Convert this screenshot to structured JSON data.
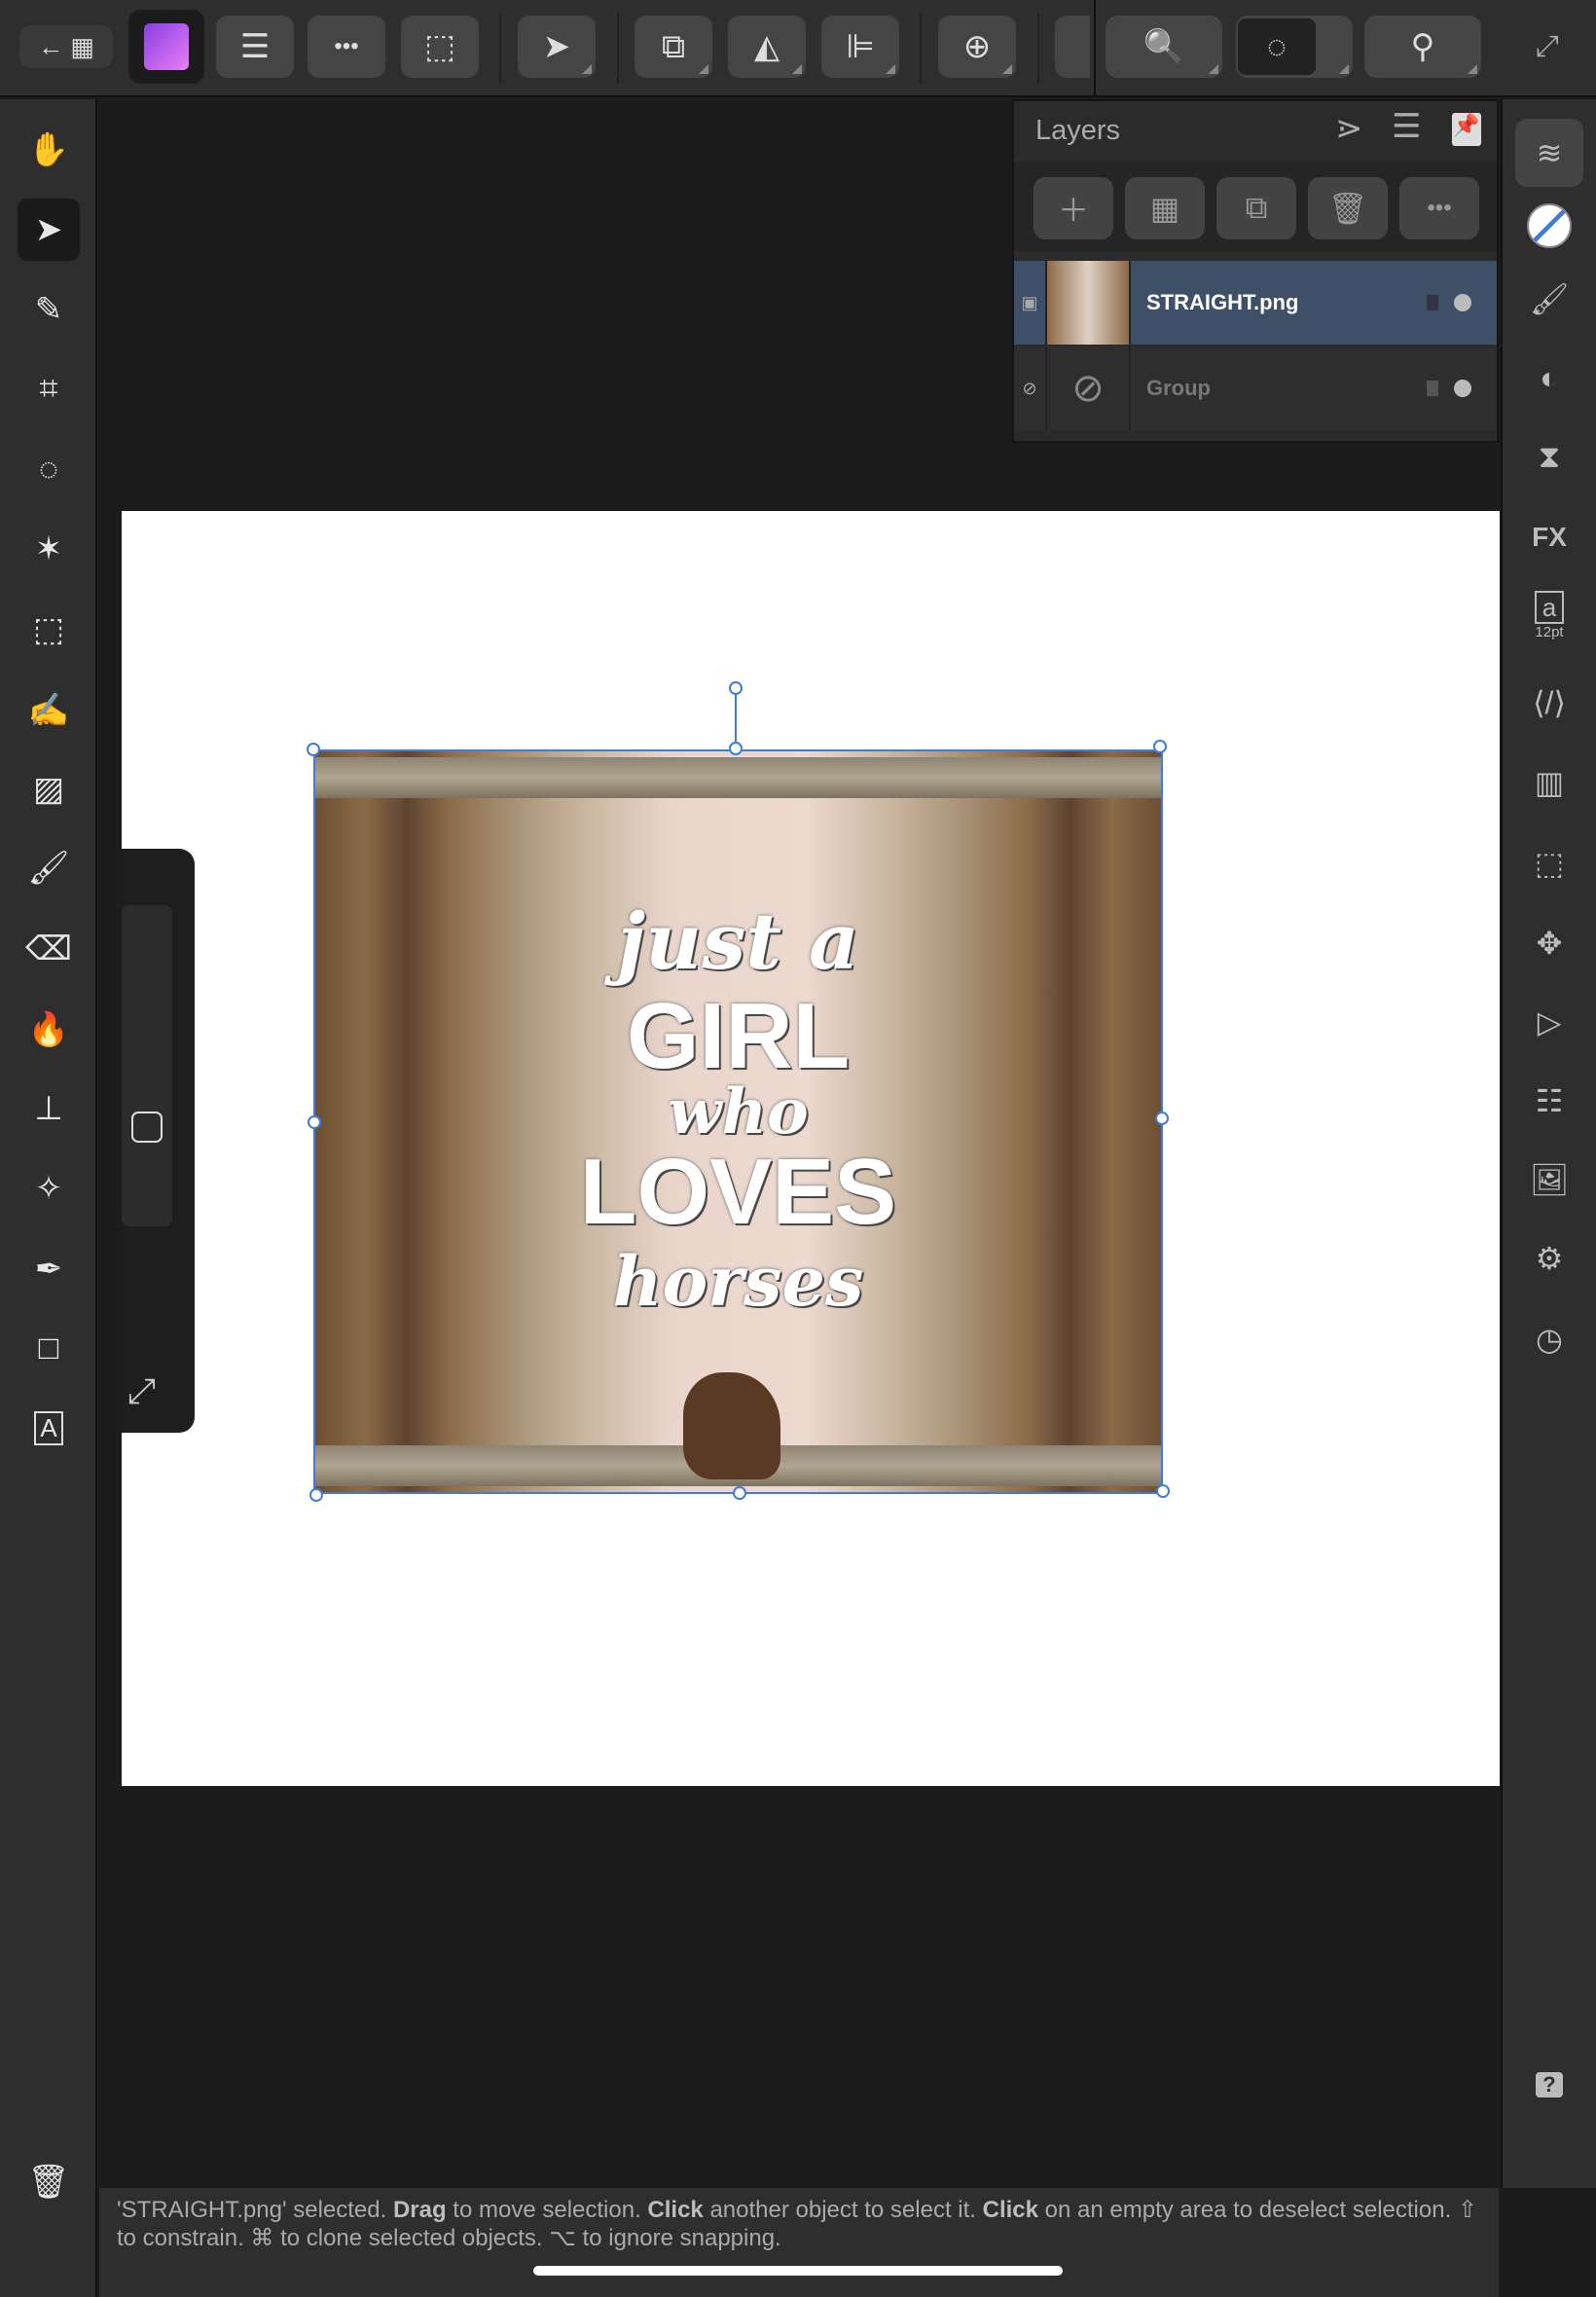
{
  "toolbar": {
    "back": "←",
    "grid": "▦",
    "app": "Affinity Photo",
    "menu": "☰",
    "more": "•••",
    "selection": "⬚",
    "move": "➤",
    "arrange": "⧉",
    "flip": "◭",
    "align": "⊫",
    "add": "⊕",
    "zoom": "🔍",
    "view": "◌",
    "snap": "⚲",
    "fullscreen": "⤢"
  },
  "layers": {
    "title": "Layers",
    "items": [
      {
        "name": "STRAIGHT.png",
        "selected": true
      },
      {
        "name": "Group",
        "selected": false
      }
    ]
  },
  "artwork": {
    "line1": "just a",
    "line2": "GIRL",
    "line3": "who",
    "line4": "LOVES",
    "line5": "horses"
  },
  "rightbar": {
    "text_size": "12pt"
  },
  "status": {
    "part1": "'STRAIGHT.png' selected. ",
    "drag": "Drag",
    "part2": " to move selection. ",
    "click1": "Click",
    "part3": " another object to select it. ",
    "click2": "Click",
    "part4": " on an empty area to deselect selection. ⇧ to constrain. ⌘ to clone selected objects. ⌥ to ignore snapping."
  },
  "help": "?",
  "colors": {
    "accent": "#3d7be0",
    "selected_row": "#3d5068",
    "app_icon": "#b44ee6"
  }
}
